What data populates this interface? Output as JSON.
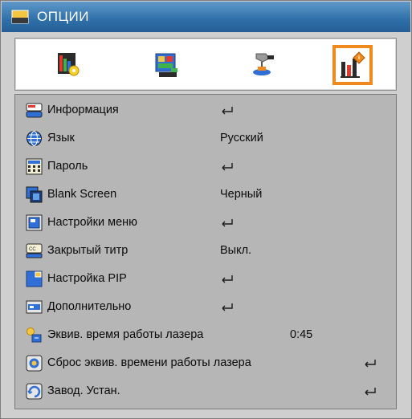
{
  "window": {
    "title": "ОПЦИИ"
  },
  "tabs": [
    {
      "name": "picture",
      "icon": "picture-settings-icon",
      "selected": false
    },
    {
      "name": "display",
      "icon": "display-settings-icon",
      "selected": false
    },
    {
      "name": "setup",
      "icon": "setup-icon",
      "selected": false
    },
    {
      "name": "options",
      "icon": "options-chart-icon",
      "selected": true
    }
  ],
  "menu": {
    "items": [
      {
        "label": "Информация",
        "value": "",
        "enter": true,
        "icon": "info-icon"
      },
      {
        "label": "Язык",
        "value": "Русский",
        "enter": false,
        "icon": "language-globe-icon"
      },
      {
        "label": "Пароль",
        "value": "",
        "enter": true,
        "icon": "password-keypad-icon"
      },
      {
        "label": "Blank Screen",
        "value": "Черный",
        "enter": false,
        "icon": "blank-screen-icon"
      },
      {
        "label": "Настройки меню",
        "value": "",
        "enter": true,
        "icon": "menu-settings-icon"
      },
      {
        "label": "Закрытый титр",
        "value": "Выкл.",
        "enter": false,
        "icon": "closed-caption-icon"
      },
      {
        "label": "Настройка PIP",
        "value": "",
        "enter": true,
        "icon": "pip-icon"
      },
      {
        "label": "Дополнительно",
        "value": "",
        "enter": true,
        "icon": "advanced-icon"
      },
      {
        "label": "Эквив. время работы лазера",
        "value": "0:45",
        "enter": false,
        "icon": "laser-hours-icon"
      },
      {
        "label": "Сброс эквив. времени работы лазера",
        "value": "",
        "enter": true,
        "icon": "laser-reset-icon"
      },
      {
        "label": "Завод. Устан.",
        "value": "",
        "enter": true,
        "icon": "factory-reset-icon"
      }
    ]
  },
  "colors": {
    "title_bar": "#2f6fa8",
    "selection": "#f08a1c",
    "menu_bg": "#b6b6b6"
  }
}
